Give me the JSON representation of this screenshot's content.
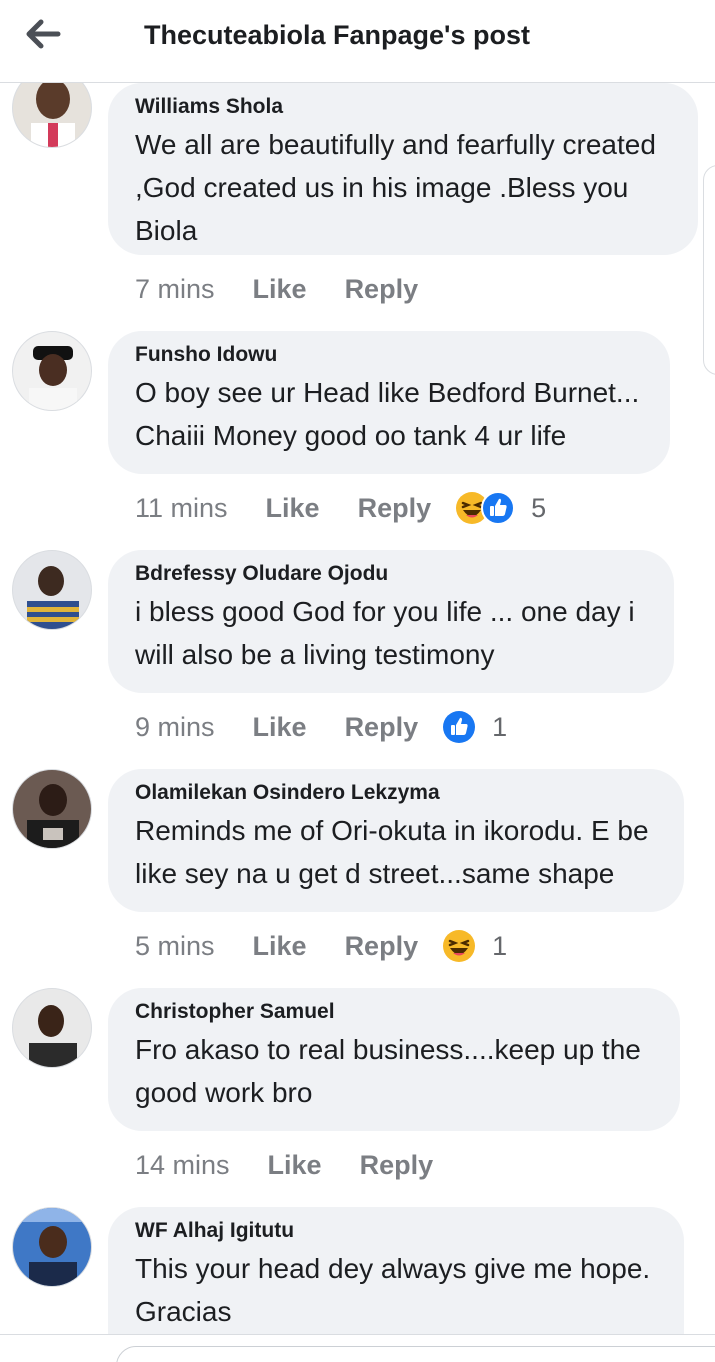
{
  "header": {
    "title": "Thecuteabiola Fanpage's post",
    "back_icon": "arrow-left-icon"
  },
  "actions": {
    "like_label": "Like",
    "reply_label": "Reply"
  },
  "comments": [
    {
      "author": "Williams Shola",
      "text": "We all are beautifully and fearfully created ,God created us in his image .Bless you Biola",
      "time": "7 mins",
      "reactions": [],
      "reaction_count": ""
    },
    {
      "author": "Funsho Idowu",
      "text": "O boy see ur Head like Bedford Burnet... Chaiii Money good oo tank 4 ur life",
      "time": "11 mins",
      "reactions": [
        "haha-emoji-icon",
        "like-emoji-icon"
      ],
      "reaction_count": "5"
    },
    {
      "author": "Bdrefessy Oludare Ojodu",
      "text": "i bless good God for you life ... one day i will also be a living testimony",
      "time": "9 mins",
      "reactions": [
        "like-emoji-icon"
      ],
      "reaction_count": "1"
    },
    {
      "author": "Olamilekan Osindero Lekzyma",
      "text": "Reminds me of Ori-okuta in ikorodu. E be like sey na u get d street...same shape",
      "time": "5 mins",
      "reactions": [
        "haha-emoji-icon"
      ],
      "reaction_count": "1"
    },
    {
      "author": "Christopher Samuel",
      "text": "Fro akaso to real business....keep up the good work bro",
      "time": "14 mins",
      "reactions": [],
      "reaction_count": ""
    },
    {
      "author": "WF Alhaj Igitutu",
      "text": "This your head dey always give me hope. Gracias",
      "time": "",
      "reactions": [],
      "reaction_count": ""
    }
  ],
  "colors": {
    "bubble": "#f0f2f5",
    "meta_text": "#7b7e83",
    "like_blue": "#1877f2",
    "haha_yellow": "#f7b928"
  }
}
